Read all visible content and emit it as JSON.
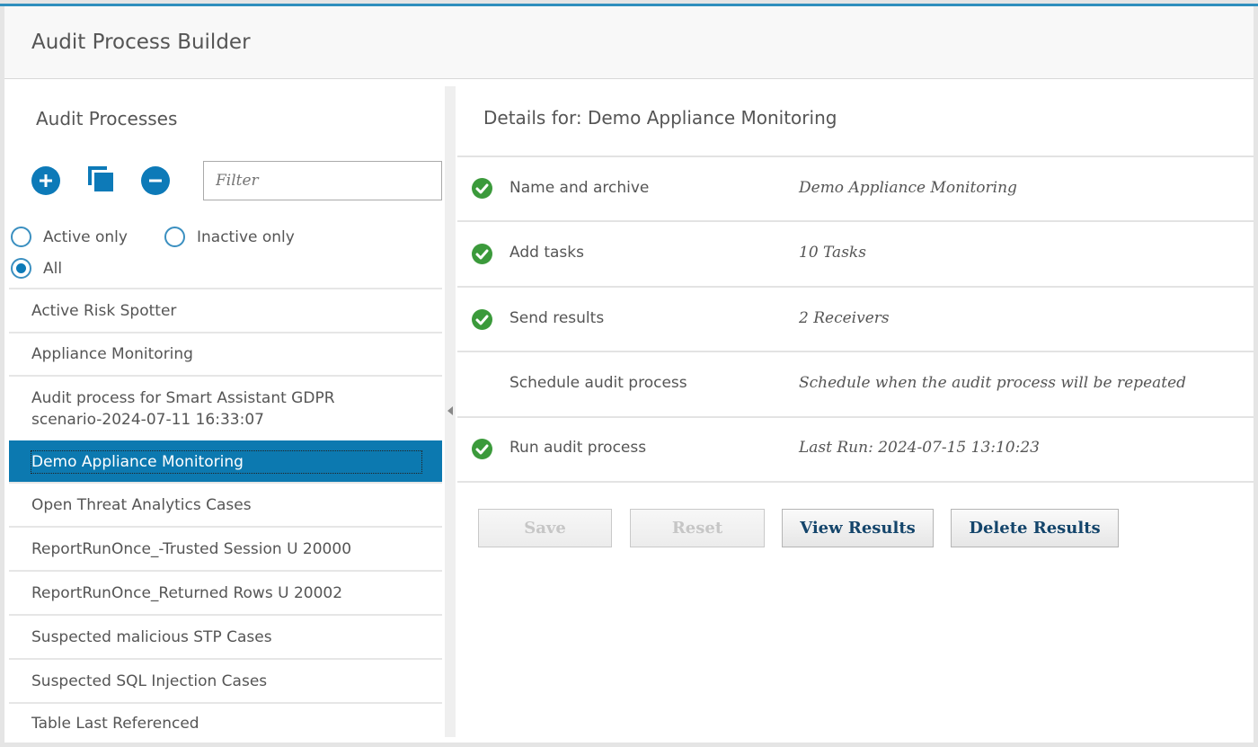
{
  "app": {
    "title": "Audit Process Builder"
  },
  "left": {
    "title": "Audit Processes",
    "toolbar": {
      "add_icon": "plus-circle-icon",
      "copy_icon": "copy-icon",
      "remove_icon": "minus-circle-icon"
    },
    "filter": {
      "placeholder": "Filter",
      "value": ""
    },
    "radios": [
      {
        "label": "Active only",
        "checked": false
      },
      {
        "label": "Inactive only",
        "checked": false
      },
      {
        "label": "All",
        "checked": true
      }
    ],
    "items": [
      {
        "label": "Active Risk Spotter",
        "selected": false
      },
      {
        "label": "Appliance Monitoring",
        "selected": false
      },
      {
        "label": "Audit process for Smart Assistant GDPR scenario-2024-07-11 16:33:07",
        "selected": false
      },
      {
        "label": "Demo Appliance Monitoring",
        "selected": true
      },
      {
        "label": "Open Threat Analytics Cases",
        "selected": false
      },
      {
        "label": "ReportRunOnce_-Trusted Session U 20000",
        "selected": false
      },
      {
        "label": "ReportRunOnce_Returned Rows U 20002",
        "selected": false
      },
      {
        "label": "Suspected malicious STP Cases",
        "selected": false
      },
      {
        "label": "Suspected SQL Injection Cases",
        "selected": false
      },
      {
        "label": "Table Last Referenced",
        "selected": false
      }
    ]
  },
  "details": {
    "title": "Details for: Demo Appliance Monitoring",
    "steps": [
      {
        "label": "Name and archive",
        "value": "Demo Appliance Monitoring",
        "complete": true
      },
      {
        "label": "Add tasks",
        "value": "10 Tasks",
        "complete": true
      },
      {
        "label": "Send results",
        "value": "2 Receivers",
        "complete": true
      },
      {
        "label": "Schedule audit process",
        "value": "Schedule when the audit process will be repeated",
        "complete": false
      },
      {
        "label": "Run audit process",
        "value": "Last Run: 2024-07-15 13:10:23",
        "complete": true
      }
    ],
    "buttons": {
      "save": "Save",
      "reset": "Reset",
      "view_results": "View Results",
      "delete_results": "Delete Results"
    }
  },
  "colors": {
    "accent": "#0c79b0",
    "check": "#3b9a3b",
    "button_text": "#14456b"
  }
}
